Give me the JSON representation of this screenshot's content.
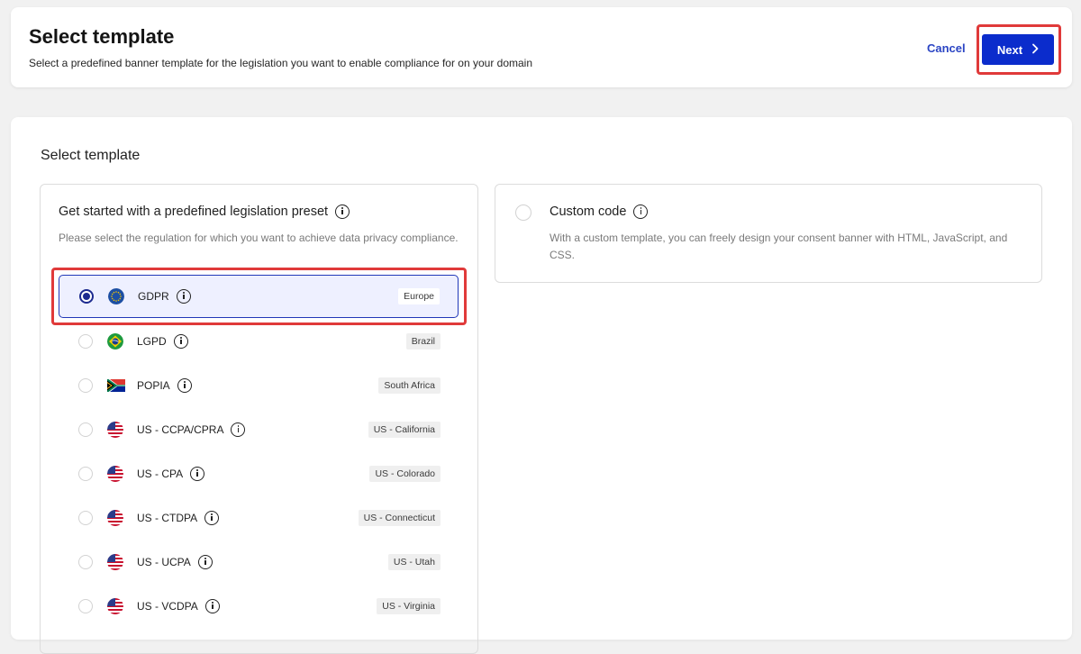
{
  "header": {
    "title": "Select template",
    "subtitle": "Select a predefined banner template for the legislation you want to enable compliance for on your domain",
    "cancel_label": "Cancel",
    "next_label": "Next",
    "next_icon": "chevron-right-icon"
  },
  "main": {
    "section_title": "Select template",
    "preset": {
      "title": "Get started with a predefined legislation preset",
      "description": "Please select the regulation for which you want to achieve data privacy compliance.",
      "selected": "GDPR",
      "items": [
        {
          "label": "GDPR",
          "region": "Europe",
          "flag": "eu-flag-icon",
          "selected": true
        },
        {
          "label": "LGPD",
          "region": "Brazil",
          "flag": "brazil-flag-icon",
          "selected": false
        },
        {
          "label": "POPIA",
          "region": "South Africa",
          "flag": "south-africa-flag-icon",
          "selected": false
        },
        {
          "label": "US - CCPA/CPRA",
          "region": "US - California",
          "flag": "us-flag-icon",
          "selected": false
        },
        {
          "label": "US - CPA",
          "region": "US - Colorado",
          "flag": "us-flag-icon",
          "selected": false
        },
        {
          "label": "US - CTDPA",
          "region": "US - Connecticut",
          "flag": "us-flag-icon",
          "selected": false
        },
        {
          "label": "US - UCPA",
          "region": "US - Utah",
          "flag": "us-flag-icon",
          "selected": false
        },
        {
          "label": "US - VCDPA",
          "region": "US - Virginia",
          "flag": "us-flag-icon",
          "selected": false
        }
      ]
    },
    "custom": {
      "title": "Custom code",
      "description": "With a custom template, you can freely design your consent banner with HTML, JavaScript, and CSS."
    }
  },
  "colors": {
    "accent": "#0b2ccc",
    "highlight": "#e03a3a",
    "selected_bg": "#eef0ff"
  }
}
